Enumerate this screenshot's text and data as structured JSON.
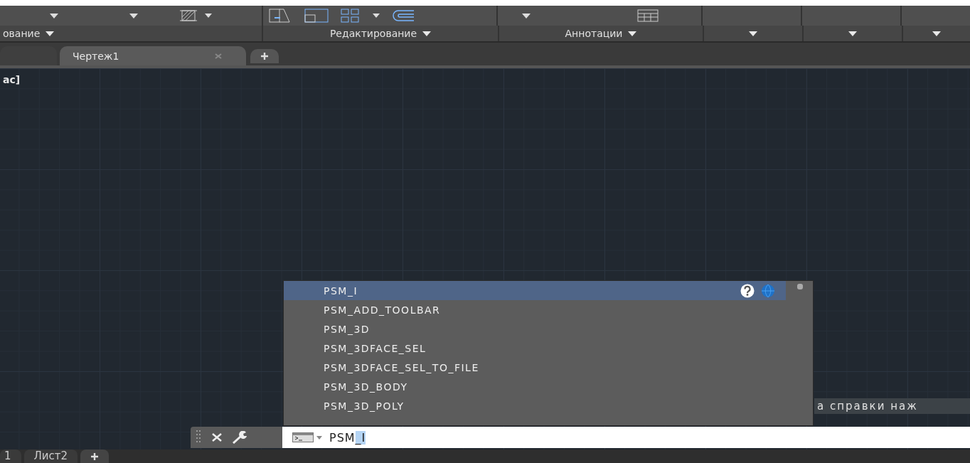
{
  "ribbon": {
    "panels": [
      {
        "kind": "labeled",
        "label": "ование"
      },
      {
        "kind": "labeled",
        "label": "Редактирование"
      },
      {
        "kind": "labeled",
        "label": "Аннотации"
      },
      {
        "kind": "blank"
      },
      {
        "kind": "blank"
      },
      {
        "kind": "blank"
      }
    ]
  },
  "file_tabs": [
    {
      "label": "Чертеж1",
      "selected": true
    }
  ],
  "canvas": {
    "viewport_label": "ас]",
    "hint": "а справки наж"
  },
  "autocomplete": {
    "items": [
      {
        "label": "PSM_I",
        "selected": true
      },
      {
        "label": "PSM_ADD_TOOLBAR",
        "selected": false
      },
      {
        "label": "PSM_3D",
        "selected": false
      },
      {
        "label": "PSM_3DFACE_SEL",
        "selected": false
      },
      {
        "label": "PSM_3DFACE_SEL_TO_FILE",
        "selected": false
      },
      {
        "label": "PSM_3D_BODY",
        "selected": false
      },
      {
        "label": "PSM_3D_POLY",
        "selected": false
      }
    ]
  },
  "command_line": {
    "value": "PSM",
    "selection": "_I"
  },
  "layout_tabs": [
    {
      "label": "1"
    },
    {
      "label": "Лист2"
    }
  ]
}
